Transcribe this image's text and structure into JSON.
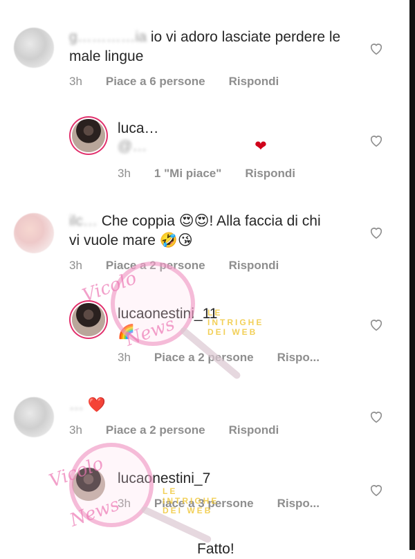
{
  "comments": [
    {
      "user": "g…………ia",
      "text": "io vi adoro lasciate perdere le male lingue",
      "time": "3h",
      "likes": "Piace a 6 persone",
      "reply": "Rispondi"
    },
    {
      "user": "luca…",
      "text": "@…",
      "time": "3h",
      "likes": "1 \"Mi piace\"",
      "reply": "Rispondi"
    },
    {
      "user": "ilc…",
      "text": "Che coppia 😍😍! Alla faccia di chi vi vuole mare 🤣😘",
      "time": "3h",
      "likes": "Piace a 2 persone",
      "reply": "Rispondi"
    },
    {
      "user": "lucaonestini_11",
      "text": "🌈",
      "time": "3h",
      "likes": "Piace a 2 persone",
      "reply": "Rispo..."
    },
    {
      "user": "…",
      "text": "❤️",
      "time": "3h",
      "likes": "Piace a 2 persone",
      "reply": "Rispondi"
    },
    {
      "user": "lucaonestini_7",
      "text": "",
      "time": "3h",
      "likes": "Piace a 3 persone",
      "reply": "Rispo..."
    },
    {
      "user": "",
      "text": "Fatto!",
      "time": "",
      "likes": "",
      "reply": ""
    }
  ],
  "watermark": {
    "line1": "Vicolo",
    "line2": "News",
    "band": "LE INTRIGHE DEI WEB"
  },
  "colors": {
    "heart_red": "#d0021b",
    "meta_gray": "#8e8e8e",
    "story_ring": "#e1306c"
  }
}
